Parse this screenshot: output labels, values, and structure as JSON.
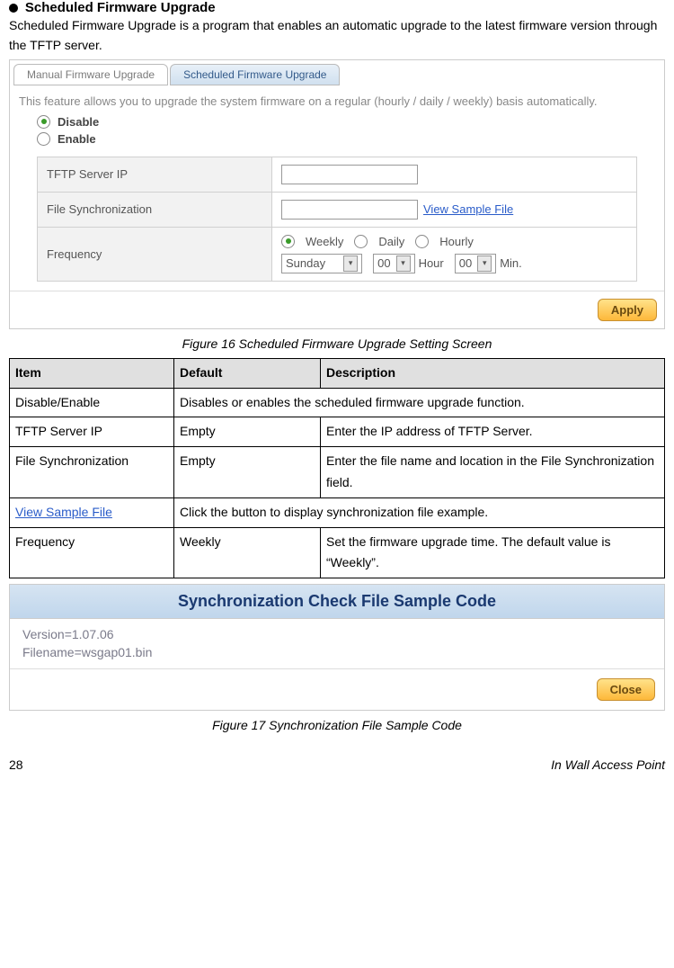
{
  "section": {
    "title": "Scheduled Firmware Upgrade",
    "description": "Scheduled Firmware Upgrade is a program that enables an automatic upgrade to the latest firmware version through the TFTP server."
  },
  "screenshot1": {
    "tabs": {
      "manual": "Manual Firmware Upgrade",
      "scheduled": "Scheduled Firmware Upgrade"
    },
    "feature_desc": "This feature allows you to upgrade the system firmware on a regular (hourly / daily / weekly) basis automatically.",
    "radio_disable": "Disable",
    "radio_enable": "Enable",
    "row_tftp": "TFTP Server IP",
    "row_filesync": "File Synchronization",
    "view_sample": "View Sample File",
    "row_frequency": "Frequency",
    "freq_weekly": "Weekly",
    "freq_daily": "Daily",
    "freq_hourly": "Hourly",
    "freq_day": "Sunday",
    "freq_hour_val": "00",
    "freq_hour_label": "Hour",
    "freq_min_val": "00",
    "freq_min_label": "Min.",
    "apply": "Apply"
  },
  "caption1": "Figure 16 Scheduled Firmware Upgrade Setting Screen",
  "table": {
    "headers": {
      "item": "Item",
      "default": "Default",
      "description": "Description"
    },
    "rows": {
      "r1": {
        "item": "Disable/Enable",
        "default": "",
        "desc": "Disables or enables the scheduled firmware upgrade function."
      },
      "r2": {
        "item": "TFTP Server IP",
        "default": "Empty",
        "desc": "Enter the IP address of TFTP Server."
      },
      "r3": {
        "item": "File Synchronization",
        "default": "Empty",
        "desc": "Enter the file name and location in the File Synchronization field."
      },
      "r4": {
        "item": "View Sample File",
        "desc": "Click the button to display synchronization file example."
      },
      "r5": {
        "item": "Frequency",
        "default": "Weekly",
        "desc": "Set the firmware upgrade time. The default value is “Weekly”."
      }
    }
  },
  "sample": {
    "header": "Synchronization Check File Sample Code",
    "line1": "Version=1.07.06",
    "line2": "Filename=wsgap01.bin",
    "close": "Close"
  },
  "caption2": "Figure 17 Synchronization File Sample Code",
  "footer": {
    "page": "28",
    "book": "In Wall Access Point"
  }
}
